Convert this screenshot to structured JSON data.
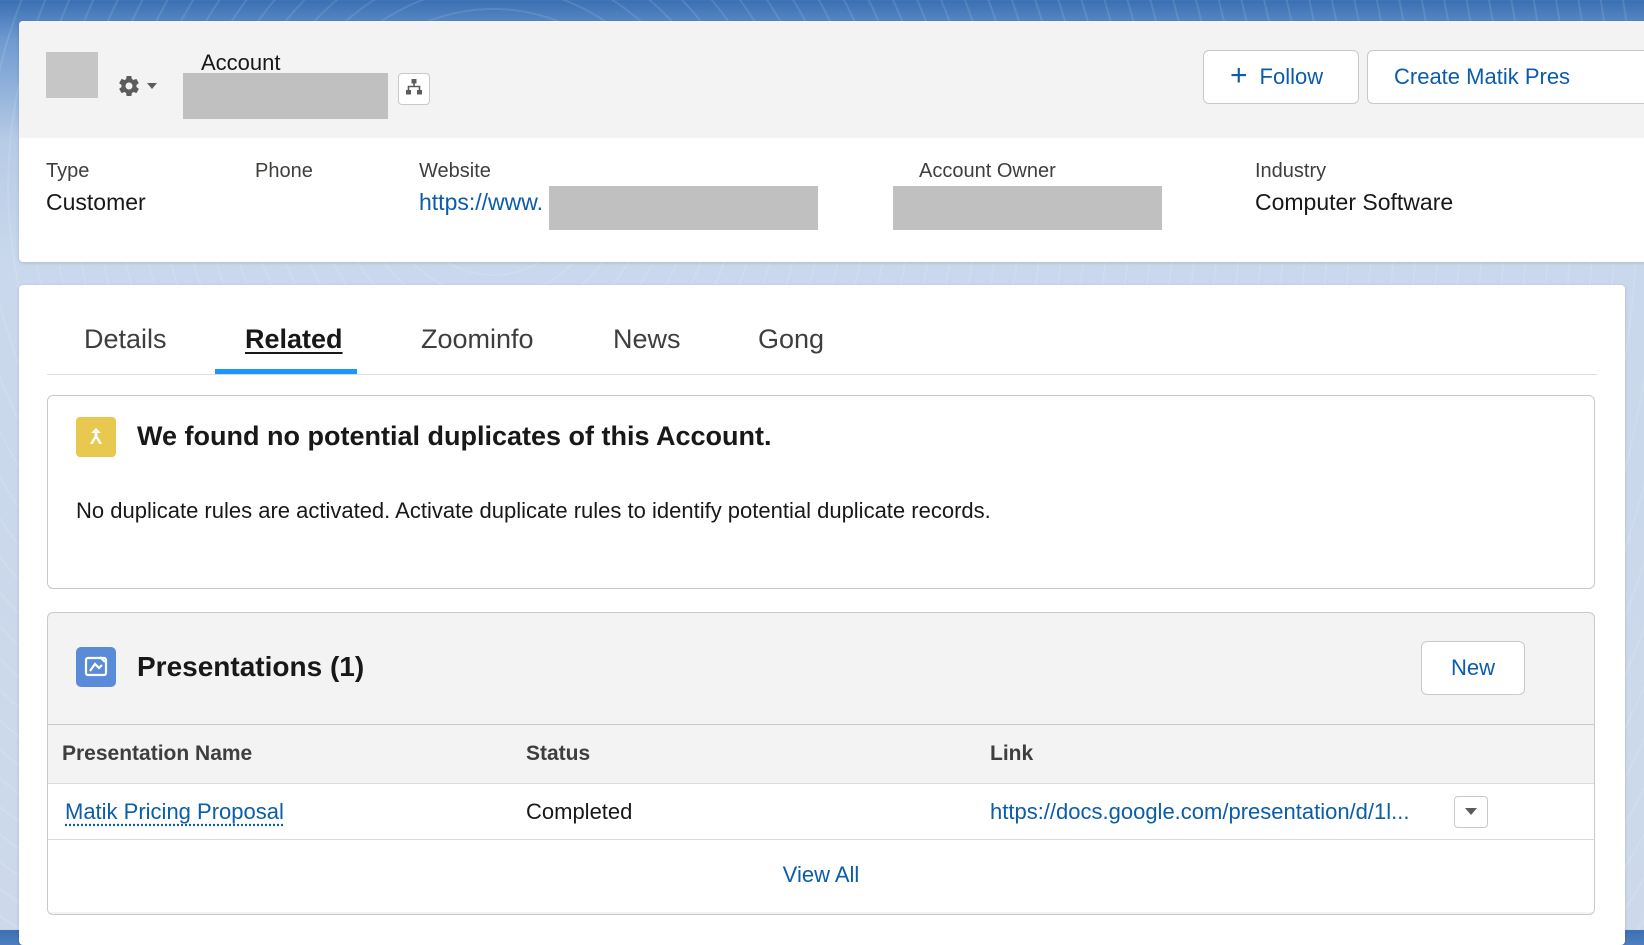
{
  "header": {
    "object_label": "Account",
    "follow_label": "Follow",
    "create_label": "Create Matik Pres"
  },
  "highlights": {
    "type_label": "Type",
    "type_value": "Customer",
    "phone_label": "Phone",
    "website_label": "Website",
    "website_value": "https://www.",
    "owner_label": "Account Owner",
    "industry_label": "Industry",
    "industry_value": "Computer Software"
  },
  "tabs": [
    {
      "label": "Details"
    },
    {
      "label": "Related"
    },
    {
      "label": "Zoominfo"
    },
    {
      "label": "News"
    },
    {
      "label": "Gong"
    }
  ],
  "active_tab": "Related",
  "duplicates": {
    "title": "We found no potential duplicates of this Account.",
    "message": "No duplicate rules are activated. Activate duplicate rules to identify potential duplicate records."
  },
  "presentations": {
    "title": "Presentations (1)",
    "new_label": "New",
    "columns": [
      "Presentation Name",
      "Status",
      "Link"
    ],
    "rows": [
      {
        "name": "Matik Pricing Proposal",
        "status": "Completed",
        "link": "https://docs.google.com/presentation/d/1l..."
      }
    ],
    "view_all_label": "View All"
  },
  "colors": {
    "link": "#0b5cab",
    "tab_active_indicator": "#1b96ff",
    "duplicate_icon_bg": "#e8c84f",
    "presentation_icon_bg": "#5a8bd8"
  }
}
